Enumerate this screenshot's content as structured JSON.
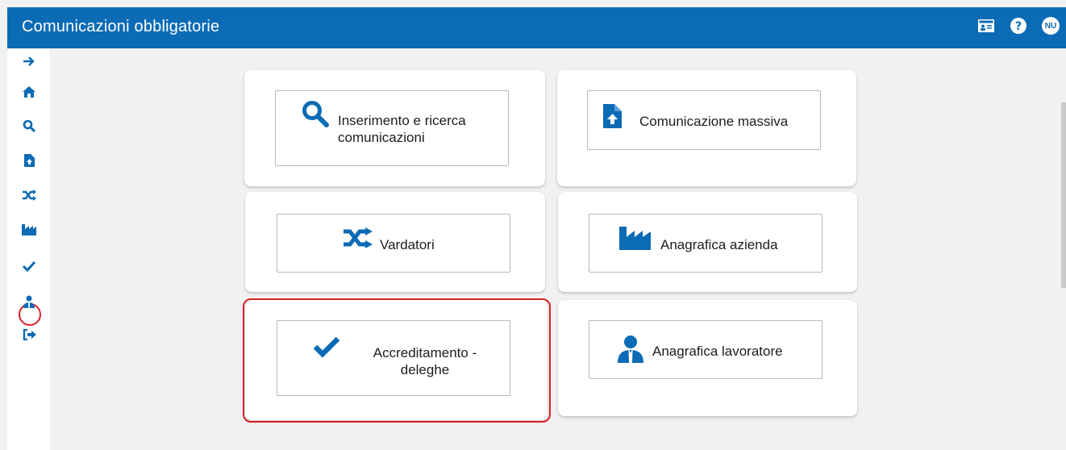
{
  "header": {
    "title": "Comunicazioni obbligatorie",
    "user_initials": "NU",
    "icons": [
      "id-card-icon",
      "help-icon",
      "user-avatar"
    ]
  },
  "sidebar": {
    "items": [
      {
        "icon": "expand-arrow-icon"
      },
      {
        "icon": "home-icon"
      },
      {
        "icon": "search-icon"
      },
      {
        "icon": "file-upload-icon"
      },
      {
        "icon": "shuffle-icon"
      },
      {
        "icon": "factory-icon"
      },
      {
        "icon": "checkmark-icon",
        "selected": true
      },
      {
        "icon": "user-tie-icon"
      },
      {
        "icon": "sign-out-icon"
      }
    ]
  },
  "tiles": [
    {
      "label": "Inserimento e ricerca comunicazioni",
      "icon": "search-icon"
    },
    {
      "label": "Comunicazione massiva",
      "icon": "file-upload-icon"
    },
    {
      "label": "Vardatori",
      "icon": "shuffle-icon"
    },
    {
      "label": "Anagrafica azienda",
      "icon": "factory-icon"
    },
    {
      "label": "Accreditamento - deleghe",
      "icon": "checkmark-icon",
      "highlighted": true
    },
    {
      "label": "Anagrafica lavoratore",
      "icon": "user-tie-icon"
    }
  ],
  "colors": {
    "brand": "#0b6bb5",
    "highlight": "#d8222a",
    "background": "#f1f1f1"
  }
}
